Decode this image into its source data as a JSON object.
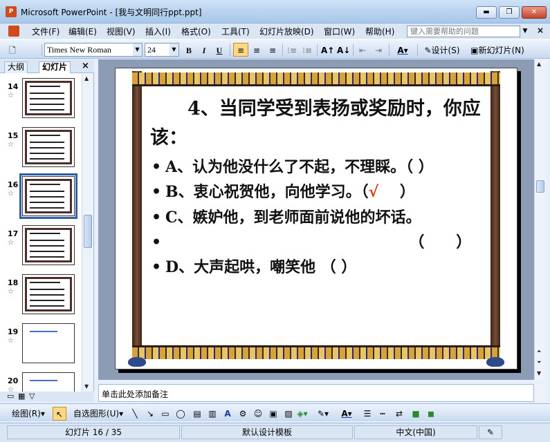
{
  "window": {
    "title": "Microsoft PowerPoint - [我与文明同行ppt.ppt]",
    "minimize": "▬",
    "restore": "❐",
    "close": "✕"
  },
  "menu": {
    "items": [
      "文件(F)",
      "编辑(E)",
      "视图(V)",
      "插入(I)",
      "格式(O)",
      "工具(T)",
      "幻灯片放映(D)",
      "窗口(W)",
      "帮助(H)"
    ],
    "help_placeholder": "键入需要帮助的问题",
    "close_doc": "×"
  },
  "toolbar": {
    "font_name": "Times New Roman",
    "font_size": "24",
    "bold": "B",
    "italic": "I",
    "underline": "U",
    "design_label": "设计(S)",
    "new_slide_label": "新幻灯片(N)"
  },
  "left_pane": {
    "tab_outline": "大纲",
    "tab_slides": "幻灯片",
    "close": "×",
    "slides": [
      {
        "num": "14",
        "selected": false
      },
      {
        "num": "15",
        "selected": false
      },
      {
        "num": "16",
        "selected": true
      },
      {
        "num": "17",
        "selected": false
      },
      {
        "num": "18",
        "selected": false
      },
      {
        "num": "19",
        "selected": false
      },
      {
        "num": "20",
        "selected": false
      }
    ]
  },
  "slide": {
    "title": "4、当同学受到表扬或奖励时，你应该：",
    "bullets": [
      {
        "text": "A、认为他没什么了不起，不理睬。（    ）"
      },
      {
        "text": "B、衷心祝贺他，向他学习。（",
        "mark": "√",
        "tail": "    ）"
      },
      {
        "text": "C、嫉妒他，到老师面前说他的坏话。"
      },
      {
        "text": "                                              （      ）"
      },
      {
        "text": "D、大声起哄，嘲笑他 （      ）"
      }
    ],
    "bullet_char": "•"
  },
  "notes": {
    "placeholder": "单击此处添加备注"
  },
  "drawbar": {
    "draw_label": "绘图(R)",
    "autoshape_label": "自选图形(U)"
  },
  "status": {
    "slide_info": "幻灯片 16 / 35",
    "template": "默认设计模板",
    "language": "中文(中国)"
  }
}
